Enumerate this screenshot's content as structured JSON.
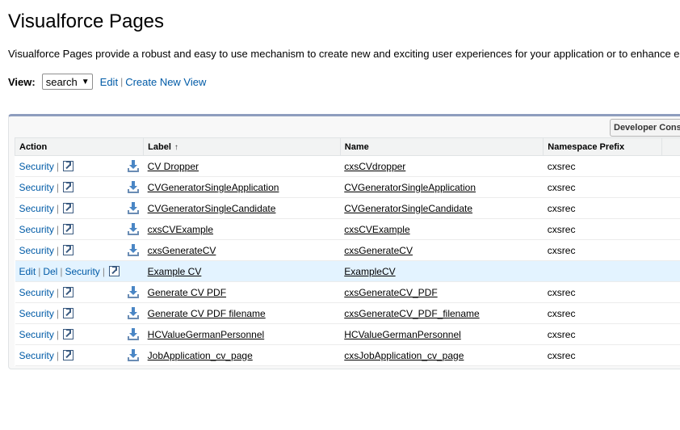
{
  "page": {
    "title": "Visualforce Pages",
    "description": "Visualforce Pages provide a robust and easy to use mechanism to create new and exciting user experiences for your application or to enhance e"
  },
  "view_bar": {
    "label": "View:",
    "selected": "search",
    "edit_link": "Edit",
    "separator": "|",
    "create_link": "Create New View"
  },
  "toolbar": {
    "dev_console_label": "Developer Console"
  },
  "table": {
    "headers": {
      "action": "Action",
      "label": "Label",
      "label_sort": "↑",
      "name": "Name",
      "namespace": "Namespace Prefix"
    },
    "action_labels": {
      "security": "Security",
      "edit": "Edit",
      "del": "Del",
      "sep": "|"
    },
    "rows": [
      {
        "label": "CV Dropper",
        "name": "cxsCVdropper",
        "namespace": "cxsrec",
        "managed": true
      },
      {
        "label": "CVGeneratorSingleApplication",
        "name": "CVGeneratorSingleApplication",
        "namespace": "cxsrec",
        "managed": true
      },
      {
        "label": "CVGeneratorSingleCandidate",
        "name": "CVGeneratorSingleCandidate",
        "namespace": "cxsrec",
        "managed": true
      },
      {
        "label": "cxsCVExample",
        "name": "cxsCVExample",
        "namespace": "cxsrec",
        "managed": true
      },
      {
        "label": "cxsGenerateCV",
        "name": "cxsGenerateCV",
        "namespace": "cxsrec",
        "managed": true
      },
      {
        "label": "Example CV",
        "name": "ExampleCV",
        "namespace": "",
        "managed": false
      },
      {
        "label": "Generate CV PDF",
        "name": "cxsGenerateCV_PDF",
        "namespace": "cxsrec",
        "managed": true
      },
      {
        "label": "Generate CV PDF filename",
        "name": "cxsGenerateCV_PDF_filename",
        "namespace": "cxsrec",
        "managed": true
      },
      {
        "label": "HCValueGermanPersonnel",
        "name": "HCValueGermanPersonnel",
        "namespace": "cxsrec",
        "managed": true
      },
      {
        "label": "JobApplication_cv_page",
        "name": "cxsJobApplication_cv_page",
        "namespace": "cxsrec",
        "managed": true
      }
    ]
  },
  "colors": {
    "link": "#015ba7",
    "highlight_row": "#e3f3ff",
    "panel_top_border": "#8e9dbe"
  }
}
